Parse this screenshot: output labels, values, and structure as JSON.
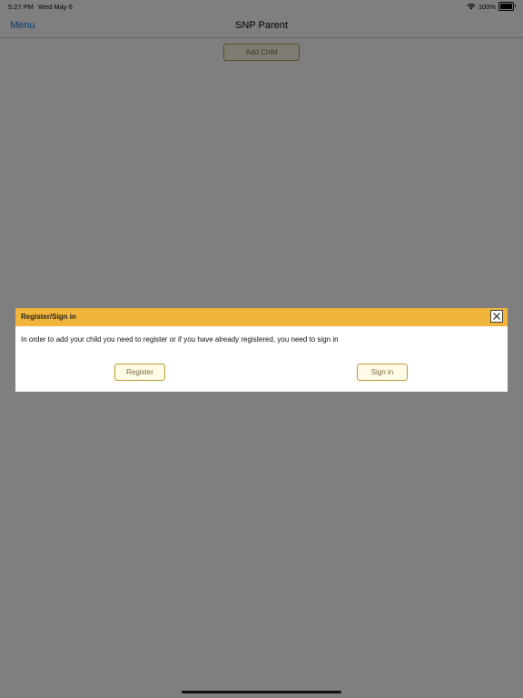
{
  "status_bar": {
    "time": "5:27 PM",
    "date": "Wed May 6",
    "battery": "100%",
    "wifi_icon": "wifi-icon",
    "battery_icon": "battery-icon"
  },
  "nav": {
    "menu_label": "Menu",
    "title": "SNP Parent"
  },
  "main": {
    "add_child_label": "Add Child"
  },
  "dialog": {
    "title": "Register/Sign in",
    "message": "In order to add your child you need to register or if you have already registered, you need to sign in",
    "register_label": "Register",
    "signin_label": "Sign in",
    "close_icon": "close-icon"
  },
  "colors": {
    "accent_blue": "#1a73e8",
    "dialog_header": "#f2b53b",
    "button_bg": "#fffbe6",
    "button_border": "#b79a3c",
    "overlay": "rgba(0,0,0,0.5)"
  }
}
